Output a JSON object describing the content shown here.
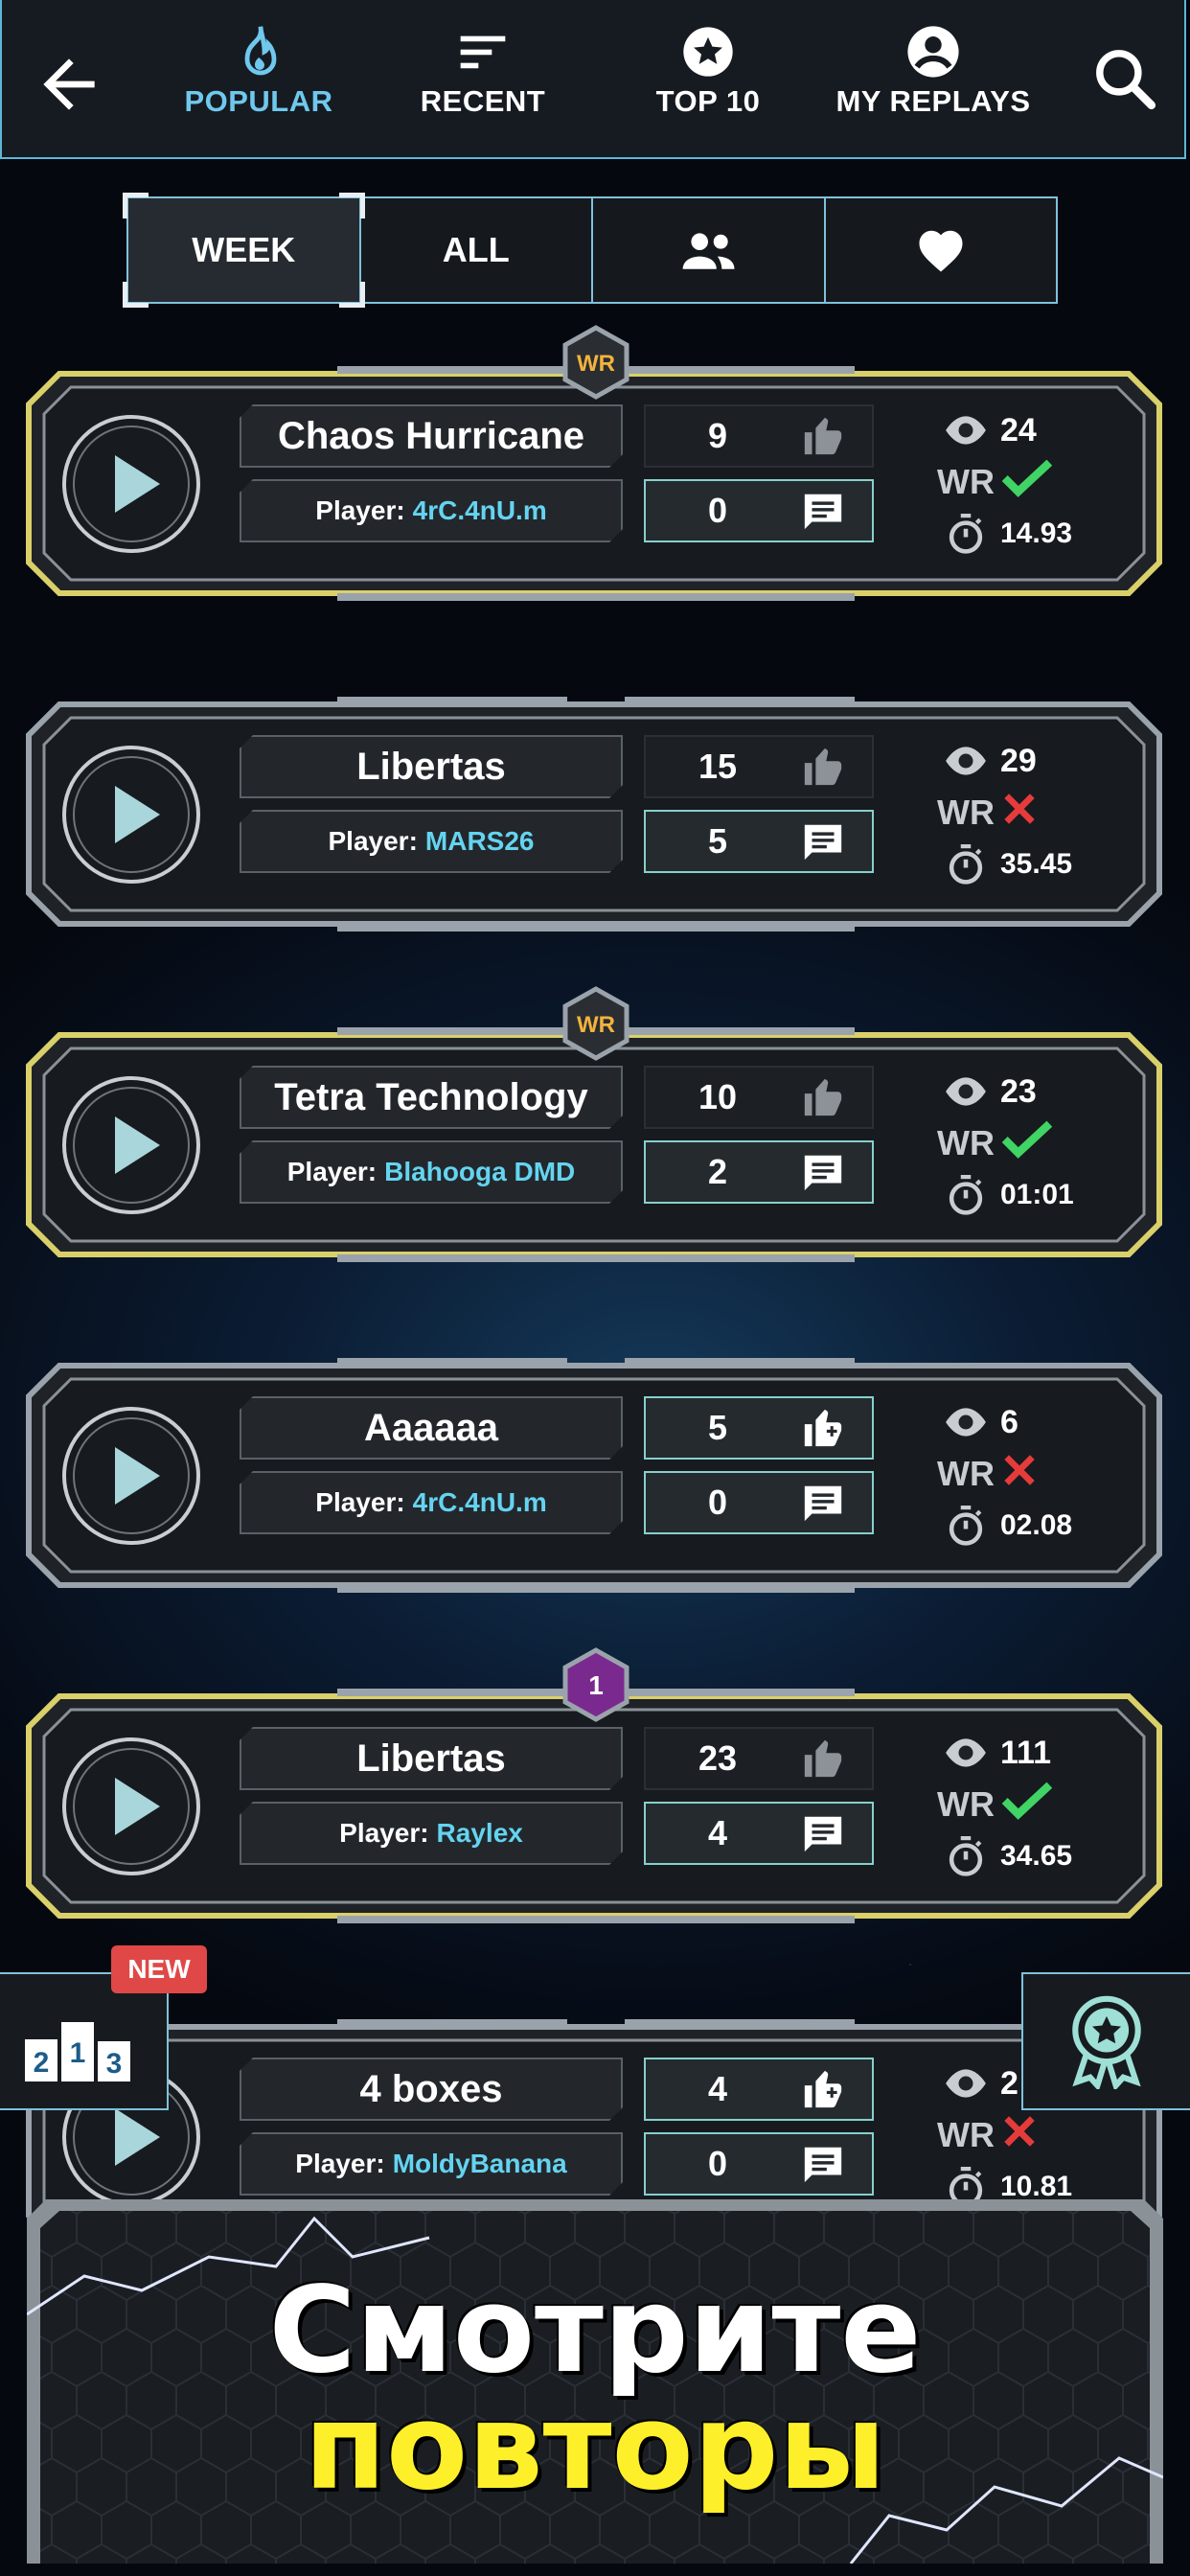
{
  "nav": {
    "tabs": [
      {
        "label": "POPULAR",
        "icon": "flame-icon",
        "active": true
      },
      {
        "label": "RECENT",
        "icon": "sort-lines-icon",
        "active": false
      },
      {
        "label": "TOP 10",
        "icon": "star-circle-icon",
        "active": false
      },
      {
        "label": "MY REPLAYS",
        "icon": "account-circle-icon",
        "active": false
      }
    ]
  },
  "filters": {
    "week": "WEEK",
    "all": "ALL",
    "friends_icon": "group-icon",
    "favorites_icon": "heart-icon",
    "active": "WEEK"
  },
  "player_prefix": "Player:",
  "wr_label": "WR",
  "replays": [
    {
      "title": "Chaos Hurricane",
      "player": "4rC.4nU.m",
      "likes": "9",
      "comments": "0",
      "views": "24",
      "wr": true,
      "time": "14.93",
      "badge": "WR",
      "highlight": true,
      "liked_icon": "thumb-up-icon"
    },
    {
      "title": "Libertas",
      "player": "MARS26",
      "likes": "15",
      "comments": "5",
      "views": "29",
      "wr": false,
      "time": "35.45",
      "badge": "",
      "highlight": false,
      "liked_icon": "thumb-up-icon"
    },
    {
      "title": "Tetra Technology",
      "player": "Blahooga DMD",
      "likes": "10",
      "comments": "2",
      "views": "23",
      "wr": true,
      "time": "01:01",
      "badge": "WR",
      "highlight": true,
      "liked_icon": "thumb-up-icon"
    },
    {
      "title": "Aaaaaa",
      "player": "4rC.4nU.m",
      "likes": "5",
      "comments": "0",
      "views": "6",
      "wr": false,
      "time": "02.08",
      "badge": "",
      "highlight": false,
      "liked_icon": "thumb-up-plus-icon"
    },
    {
      "title": "Libertas",
      "player": "Raylex",
      "likes": "23",
      "comments": "4",
      "views": "111",
      "wr": true,
      "time": "34.65",
      "badge": "1",
      "highlight": true,
      "liked_icon": "thumb-up-icon"
    },
    {
      "title": "4 boxes",
      "player": "MoldyBanana",
      "likes": "4",
      "comments": "0",
      "views": "2",
      "wr": false,
      "time": "10.81",
      "badge": "",
      "highlight": false,
      "liked_icon": "thumb-up-plus-icon"
    }
  ],
  "side": {
    "left_new_tag": "NEW",
    "left_icon": "podium-icon",
    "podium": [
      "2",
      "1",
      "3"
    ],
    "right_icon": "award-badge-icon"
  },
  "promo": {
    "line1": "Смотрите",
    "line2": "повторы"
  },
  "colors": {
    "accent": "#6fc8ee",
    "player_name": "#64d4f0",
    "wr_gold": "#f2b33d",
    "check": "#3fd463",
    "cross": "#e53b3b",
    "promo_yellow": "#fdf02a"
  }
}
